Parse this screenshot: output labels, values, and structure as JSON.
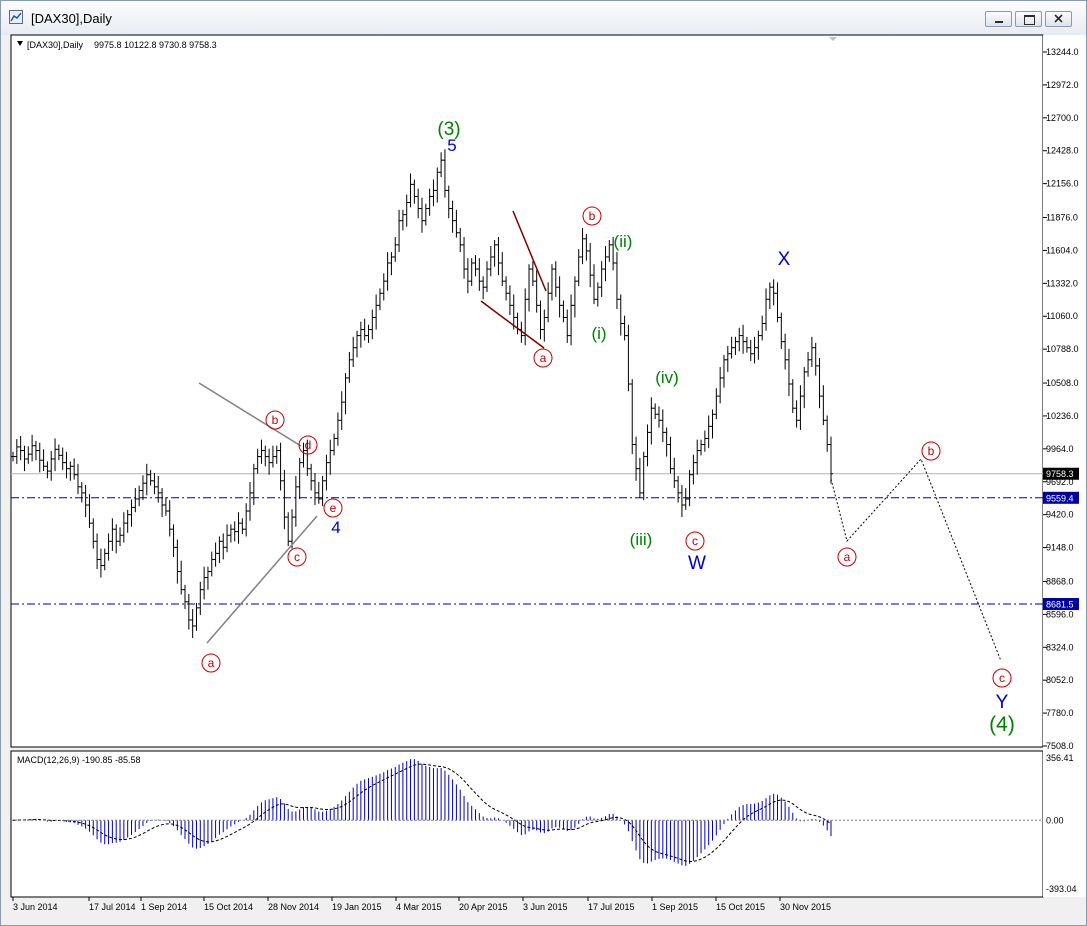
{
  "window": {
    "title": "[DAX30],Daily",
    "buttons": [
      "minimize",
      "maximize",
      "close"
    ]
  },
  "chart_data": [
    {
      "type": "line",
      "title": "[DAX30],Daily",
      "ohlc": "9975.8 10122.8 9730.8 9758.3",
      "ylim": [
        7508.0,
        13244.0
      ],
      "y_ticks": [
        "13244.0",
        "12972.0",
        "12700.0",
        "12428.0",
        "12156.0",
        "11876.0",
        "11604.0",
        "11332.0",
        "11060.0",
        "10788.0",
        "10508.0",
        "10236.0",
        "9964.0",
        "9692.0",
        "9420.0",
        "9148.0",
        "8868.0",
        "8596.0",
        "8324.0",
        "8052.0",
        "7780.0",
        "7508.0"
      ],
      "x_labels": [
        "3 Jun 2014",
        "17 Jul 2014",
        "1 Sep 2014",
        "15 Oct 2014",
        "28 Nov 2014",
        "19 Jan 2015",
        "4 Mar 2015",
        "20 Apr 2015",
        "3 Jun 2015",
        "17 Jul 2015",
        "1 Sep 2015",
        "15 Oct 2015",
        "30 Nov 2015"
      ],
      "price_badges": [
        {
          "label": "9758.3",
          "value": 9758.3,
          "color": "#000000"
        },
        {
          "label": "9559.4",
          "value": 9559.4,
          "color": "#0000a0"
        },
        {
          "label": "8681.5",
          "value": 8681.5,
          "color": "#0000a0"
        }
      ],
      "horizontal_lines": [
        {
          "value": 9758.3,
          "style": "solid",
          "color": "#b4b4b4"
        },
        {
          "value": 9559.4,
          "style": "dash-dot",
          "color": "#0000a0"
        },
        {
          "value": 8681.5,
          "style": "dash-dot",
          "color": "#0000a0"
        }
      ],
      "series": [
        {
          "values": [
            9900,
            9980,
            9950,
            9880,
            9920,
            9990,
            9950,
            9870,
            9820,
            9780,
            9880,
            9960,
            9910,
            9850,
            9800,
            9820,
            9750,
            9650,
            9600,
            9500,
            9350,
            9200,
            9050,
            9000,
            9100,
            9200,
            9300,
            9200,
            9250,
            9350,
            9420,
            9480,
            9550,
            9620,
            9680,
            9750,
            9700,
            9650,
            9600,
            9500,
            9450,
            9300,
            9150,
            8950,
            8800,
            8700,
            8550,
            8500,
            8650,
            8800,
            8900,
            8950,
            9050,
            9100,
            9200,
            9150,
            9250,
            9300,
            9280,
            9350,
            9300,
            9450,
            9600,
            9800,
            9900,
            9950,
            9900,
            9850,
            9900,
            9950,
            9700,
            9400,
            9200,
            9400,
            9650,
            9850,
            9950,
            9800,
            9700,
            9600,
            9550,
            9700,
            9850,
            9950,
            10050,
            10200,
            10350,
            10550,
            10700,
            10800,
            10900,
            10950,
            10900,
            10950,
            11050,
            11150,
            11250,
            11350,
            11500,
            11550,
            11650,
            11850,
            11900,
            12000,
            12150,
            12050,
            11950,
            11850,
            11950,
            12050,
            12100,
            12250,
            12350,
            12100,
            11950,
            11850,
            11750,
            11650,
            11450,
            11350,
            11500,
            11450,
            11350,
            11300,
            11450,
            11550,
            11650,
            11500,
            11350,
            11250,
            11150,
            11050,
            10950,
            10900,
            11200,
            11450,
            11350,
            11150,
            10950,
            11050,
            11250,
            11450,
            11300,
            11150,
            11050,
            10900,
            11150,
            11350,
            11550,
            11700,
            11600,
            11400,
            11200,
            11300,
            11450,
            11550,
            11650,
            11500,
            11200,
            11000,
            10900,
            10500,
            10000,
            9800,
            9600,
            9900,
            10100,
            10300,
            10250,
            10200,
            10100,
            10000,
            9800,
            9700,
            9600,
            9500,
            9550,
            9750,
            9850,
            9950,
            10000,
            10050,
            10150,
            10250,
            10400,
            10550,
            10700,
            10750,
            10800,
            10850,
            10900,
            10850,
            10800,
            10750,
            10800,
            10900,
            11000,
            11200,
            11300,
            11250,
            11050,
            10850,
            10700,
            10500,
            10300,
            10200,
            10400,
            10600,
            10700,
            10800,
            10650,
            10400,
            10200,
            10000,
            9758
          ]
        },
        {
          "name": "MACD(12,26,9)",
          "values": [
            -190.85,
            -85.58
          ]
        }
      ],
      "macd": {
        "label": "MACD(12,26,9) -190.85 -85.58",
        "ylim": [
          -393.04,
          356.41
        ],
        "y_ticks": [
          "356.41",
          "0.00",
          "-393.04"
        ]
      },
      "annotations": {
        "red_circled": [
          {
            "text": "a",
            "where": "Oct 2014 low"
          },
          {
            "text": "b",
            "where": "Nov 2014"
          },
          {
            "text": "c",
            "where": "Dec 2014"
          },
          {
            "text": "d",
            "where": "Dec 2014"
          },
          {
            "text": "e",
            "where": "Jan 2015"
          },
          {
            "text": "a",
            "where": "Jun 2015"
          },
          {
            "text": "b",
            "where": "Jul 2015"
          },
          {
            "text": "c",
            "where": "Sep 2015"
          },
          {
            "text": "a",
            "where": "projected"
          },
          {
            "text": "b",
            "where": "projected"
          },
          {
            "text": "c",
            "where": "projected"
          }
        ],
        "blue": [
          {
            "text": "5",
            "where": "Apr 2015 top"
          },
          {
            "text": "4",
            "where": "Jan 2015"
          },
          {
            "text": "W",
            "where": "Sep 2015"
          },
          {
            "text": "X",
            "where": "Dec 2015 top"
          },
          {
            "text": "Y",
            "where": "projected end"
          }
        ],
        "green": [
          {
            "text": "(3)",
            "where": "Apr 2015 top"
          },
          {
            "text": "(i)",
            "where": "Jul 2015"
          },
          {
            "text": "(ii)",
            "where": "Jul 2015"
          },
          {
            "text": "(iii)",
            "where": "Aug 2015"
          },
          {
            "text": "(iv)",
            "where": "Aug 2015"
          },
          {
            "text": "(4)",
            "where": "projected end"
          }
        ]
      },
      "grid": false,
      "colors": {
        "price_bars": "#000000",
        "macd_hist": "#0000c8",
        "red": "#c00000",
        "blue": "#0000c8",
        "green": "#008000",
        "guide_lines": "#0000a0"
      }
    }
  ]
}
